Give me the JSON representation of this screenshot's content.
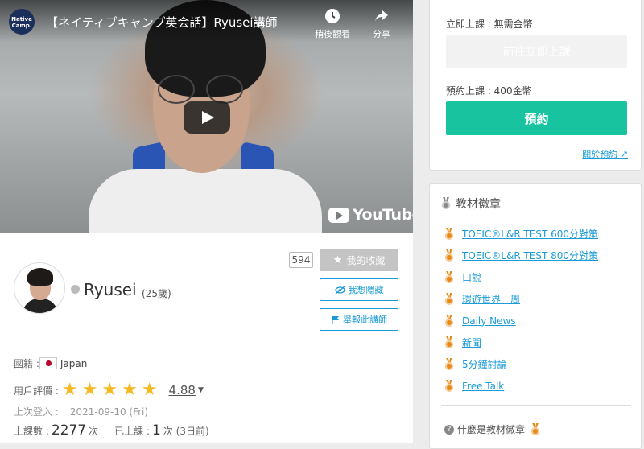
{
  "video": {
    "channel_logo_text": "Native Camp.",
    "title": "【ネイティブキャンプ英会話】Ryusei講師",
    "watch_later_label": "稍後觀看",
    "share_label": "分享",
    "brand_label": "YouTube"
  },
  "tutor": {
    "name": "Ryusei",
    "age": "(25歲)",
    "favorite_count": "594",
    "favorite_label": "我的收藏",
    "hide_label": "我想隱藏",
    "report_label": "舉報此講師"
  },
  "info": {
    "nationality_label": "國籍 :",
    "nationality_value": "Japan",
    "rating_label": "用戶評價 :",
    "stars": 5,
    "rating_value": "4.88",
    "last_login_label": "上次登入 :",
    "last_login_value": "2021-09-10 (Fri)",
    "lessons_label": "上課數 :",
    "lessons_value": "2277",
    "lessons_unit": "次",
    "last_lesson_label": "已上課 :",
    "last_lesson_value": "1",
    "last_lesson_unit": "次 (3日前)"
  },
  "booking": {
    "instant_label": "立即上課 : 無需金幣",
    "instant_button": "前往立即上課",
    "reserve_label": "預約上課 : 400金幣",
    "reserve_button": "預約",
    "about_link": "關於預約"
  },
  "badges": {
    "title": "教材徽章",
    "items": [
      "TOEIC®L&R TEST 600分對策",
      "TOEIC®L&R TEST 800分對策",
      "口說",
      "環遊世界一周",
      "Daily News",
      "新聞",
      "5分鐘討論",
      "Free Talk"
    ],
    "what_label": "什麼是教材徽章"
  },
  "colors": {
    "accent_green": "#18c3a0",
    "link_blue": "#1a9bd7",
    "star": "#f5b921",
    "medal_orange": "#e68a1a",
    "medal_grey": "#8a8a8a"
  }
}
